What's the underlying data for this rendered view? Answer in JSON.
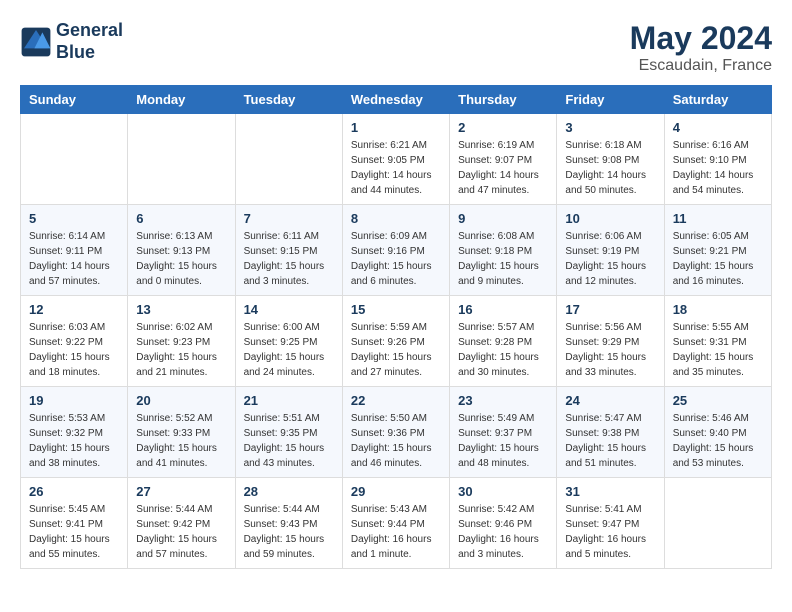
{
  "header": {
    "logo_line1": "General",
    "logo_line2": "Blue",
    "month": "May 2024",
    "location": "Escaudain, France"
  },
  "weekdays": [
    "Sunday",
    "Monday",
    "Tuesday",
    "Wednesday",
    "Thursday",
    "Friday",
    "Saturday"
  ],
  "weeks": [
    [
      {
        "day": "",
        "info": ""
      },
      {
        "day": "",
        "info": ""
      },
      {
        "day": "",
        "info": ""
      },
      {
        "day": "1",
        "info": "Sunrise: 6:21 AM\nSunset: 9:05 PM\nDaylight: 14 hours\nand 44 minutes."
      },
      {
        "day": "2",
        "info": "Sunrise: 6:19 AM\nSunset: 9:07 PM\nDaylight: 14 hours\nand 47 minutes."
      },
      {
        "day": "3",
        "info": "Sunrise: 6:18 AM\nSunset: 9:08 PM\nDaylight: 14 hours\nand 50 minutes."
      },
      {
        "day": "4",
        "info": "Sunrise: 6:16 AM\nSunset: 9:10 PM\nDaylight: 14 hours\nand 54 minutes."
      }
    ],
    [
      {
        "day": "5",
        "info": "Sunrise: 6:14 AM\nSunset: 9:11 PM\nDaylight: 14 hours\nand 57 minutes."
      },
      {
        "day": "6",
        "info": "Sunrise: 6:13 AM\nSunset: 9:13 PM\nDaylight: 15 hours\nand 0 minutes."
      },
      {
        "day": "7",
        "info": "Sunrise: 6:11 AM\nSunset: 9:15 PM\nDaylight: 15 hours\nand 3 minutes."
      },
      {
        "day": "8",
        "info": "Sunrise: 6:09 AM\nSunset: 9:16 PM\nDaylight: 15 hours\nand 6 minutes."
      },
      {
        "day": "9",
        "info": "Sunrise: 6:08 AM\nSunset: 9:18 PM\nDaylight: 15 hours\nand 9 minutes."
      },
      {
        "day": "10",
        "info": "Sunrise: 6:06 AM\nSunset: 9:19 PM\nDaylight: 15 hours\nand 12 minutes."
      },
      {
        "day": "11",
        "info": "Sunrise: 6:05 AM\nSunset: 9:21 PM\nDaylight: 15 hours\nand 16 minutes."
      }
    ],
    [
      {
        "day": "12",
        "info": "Sunrise: 6:03 AM\nSunset: 9:22 PM\nDaylight: 15 hours\nand 18 minutes."
      },
      {
        "day": "13",
        "info": "Sunrise: 6:02 AM\nSunset: 9:23 PM\nDaylight: 15 hours\nand 21 minutes."
      },
      {
        "day": "14",
        "info": "Sunrise: 6:00 AM\nSunset: 9:25 PM\nDaylight: 15 hours\nand 24 minutes."
      },
      {
        "day": "15",
        "info": "Sunrise: 5:59 AM\nSunset: 9:26 PM\nDaylight: 15 hours\nand 27 minutes."
      },
      {
        "day": "16",
        "info": "Sunrise: 5:57 AM\nSunset: 9:28 PM\nDaylight: 15 hours\nand 30 minutes."
      },
      {
        "day": "17",
        "info": "Sunrise: 5:56 AM\nSunset: 9:29 PM\nDaylight: 15 hours\nand 33 minutes."
      },
      {
        "day": "18",
        "info": "Sunrise: 5:55 AM\nSunset: 9:31 PM\nDaylight: 15 hours\nand 35 minutes."
      }
    ],
    [
      {
        "day": "19",
        "info": "Sunrise: 5:53 AM\nSunset: 9:32 PM\nDaylight: 15 hours\nand 38 minutes."
      },
      {
        "day": "20",
        "info": "Sunrise: 5:52 AM\nSunset: 9:33 PM\nDaylight: 15 hours\nand 41 minutes."
      },
      {
        "day": "21",
        "info": "Sunrise: 5:51 AM\nSunset: 9:35 PM\nDaylight: 15 hours\nand 43 minutes."
      },
      {
        "day": "22",
        "info": "Sunrise: 5:50 AM\nSunset: 9:36 PM\nDaylight: 15 hours\nand 46 minutes."
      },
      {
        "day": "23",
        "info": "Sunrise: 5:49 AM\nSunset: 9:37 PM\nDaylight: 15 hours\nand 48 minutes."
      },
      {
        "day": "24",
        "info": "Sunrise: 5:47 AM\nSunset: 9:38 PM\nDaylight: 15 hours\nand 51 minutes."
      },
      {
        "day": "25",
        "info": "Sunrise: 5:46 AM\nSunset: 9:40 PM\nDaylight: 15 hours\nand 53 minutes."
      }
    ],
    [
      {
        "day": "26",
        "info": "Sunrise: 5:45 AM\nSunset: 9:41 PM\nDaylight: 15 hours\nand 55 minutes."
      },
      {
        "day": "27",
        "info": "Sunrise: 5:44 AM\nSunset: 9:42 PM\nDaylight: 15 hours\nand 57 minutes."
      },
      {
        "day": "28",
        "info": "Sunrise: 5:44 AM\nSunset: 9:43 PM\nDaylight: 15 hours\nand 59 minutes."
      },
      {
        "day": "29",
        "info": "Sunrise: 5:43 AM\nSunset: 9:44 PM\nDaylight: 16 hours\nand 1 minute."
      },
      {
        "day": "30",
        "info": "Sunrise: 5:42 AM\nSunset: 9:46 PM\nDaylight: 16 hours\nand 3 minutes."
      },
      {
        "day": "31",
        "info": "Sunrise: 5:41 AM\nSunset: 9:47 PM\nDaylight: 16 hours\nand 5 minutes."
      },
      {
        "day": "",
        "info": ""
      }
    ]
  ]
}
